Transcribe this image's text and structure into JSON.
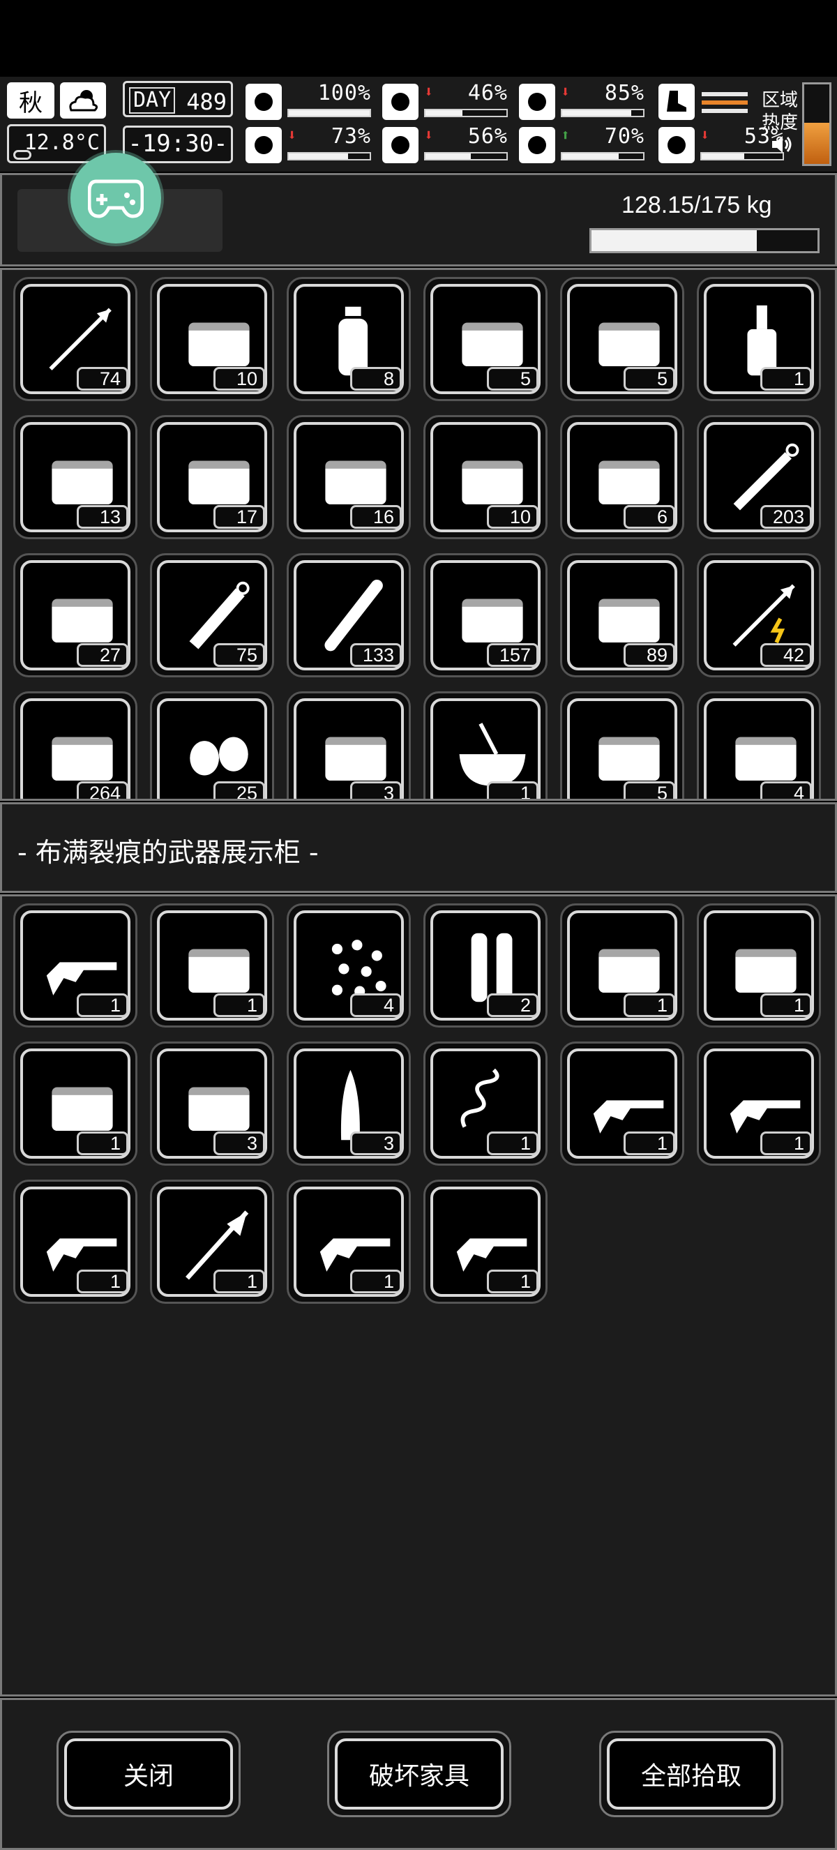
{
  "status": {
    "season": "秋",
    "temperature": "12.8°C",
    "day_label": "DAY",
    "day": "489",
    "time": "19:30",
    "zone_label_1": "区域",
    "zone_label_2": "热度",
    "stats": [
      {
        "icon": "health-icon",
        "value": "100%",
        "level": 1.0,
        "arrow": ""
      },
      {
        "icon": "stomach-icon",
        "value": "46%",
        "level": 0.46,
        "arrow": "down"
      },
      {
        "icon": "mood-icon",
        "value": "85%",
        "level": 0.85,
        "arrow": "down"
      },
      {
        "icon": "brain-icon",
        "value": "73%",
        "level": 0.73,
        "arrow": "down"
      },
      {
        "icon": "water-drop-icon",
        "value": "56%",
        "level": 0.56,
        "arrow": "down"
      },
      {
        "icon": "heart-icon",
        "value": "70%",
        "level": 0.7,
        "arrow": "up"
      },
      {
        "icon": "boot-icon",
        "value": "53%",
        "level": 0.53,
        "arrow": "down"
      }
    ],
    "arrow_colors": {
      "down": "#e53935",
      "up": "#43a047"
    }
  },
  "inventory": {
    "weight": "128.15/175 kg",
    "weight_level": 0.732,
    "items": [
      {
        "icon": "arrow-icon",
        "count": "74"
      },
      {
        "icon": "rope-icon",
        "count": "10"
      },
      {
        "icon": "water-bottle-icon",
        "count": "8"
      },
      {
        "icon": "kebab-icon",
        "count": "5"
      },
      {
        "icon": "pills-icon",
        "count": "5"
      },
      {
        "icon": "liquor-bottle-icon",
        "count": "1"
      },
      {
        "icon": "tool-bag-icon",
        "count": "13"
      },
      {
        "icon": "toolbox-icon",
        "count": "17"
      },
      {
        "icon": "tool-case-icon",
        "count": "16"
      },
      {
        "icon": "paper-roll-icon",
        "count": "10"
      },
      {
        "icon": "repair-kit-icon",
        "count": "6"
      },
      {
        "icon": "syringe-icon",
        "count": "203"
      },
      {
        "icon": "explosive-jars-icon",
        "count": "27"
      },
      {
        "icon": "injector-icon",
        "count": "75"
      },
      {
        "icon": "cigarette-icon",
        "count": "133"
      },
      {
        "icon": "fire-crate-icon",
        "count": "157"
      },
      {
        "icon": "fire-crate-icon",
        "count": "89"
      },
      {
        "icon": "electric-arrow-icon",
        "count": "42"
      },
      {
        "icon": "fire-crate-icon",
        "count": "264"
      },
      {
        "icon": "nuts-icon",
        "count": "25"
      },
      {
        "icon": "food-platter-icon",
        "count": "3"
      },
      {
        "icon": "soup-bowl-icon",
        "count": "1"
      },
      {
        "icon": "cloth-stack-icon",
        "count": "5"
      },
      {
        "icon": "bread-stack-icon",
        "count": "4"
      }
    ]
  },
  "container": {
    "title": "- 布满裂痕的武器展示柜 -",
    "items": [
      {
        "icon": "revolver-icon",
        "count": "1"
      },
      {
        "icon": "magazine-icon",
        "count": "1"
      },
      {
        "icon": "pellets-icon",
        "count": "4"
      },
      {
        "icon": "ammo-shells-icon",
        "count": "2"
      },
      {
        "icon": "gun-parts-icon",
        "count": "1"
      },
      {
        "icon": "metal-bar-icon",
        "count": "1"
      },
      {
        "icon": "metal-blocks-icon",
        "count": "1"
      },
      {
        "icon": "cans-icon",
        "count": "3"
      },
      {
        "icon": "bullet-icon",
        "count": "3"
      },
      {
        "icon": "spring-icon",
        "count": "1"
      },
      {
        "icon": "minigun-icon",
        "count": "1"
      },
      {
        "icon": "assault-rifle-icon",
        "count": "1"
      },
      {
        "icon": "ak-rifle-icon",
        "count": "1"
      },
      {
        "icon": "spear-icon",
        "count": "1"
      },
      {
        "icon": "shotgun-icon",
        "count": "1"
      },
      {
        "icon": "sniper-rifle-icon",
        "count": "1"
      }
    ]
  },
  "actions": {
    "close": "关闭",
    "destroy": "破坏家具",
    "pickup_all": "全部拾取"
  }
}
